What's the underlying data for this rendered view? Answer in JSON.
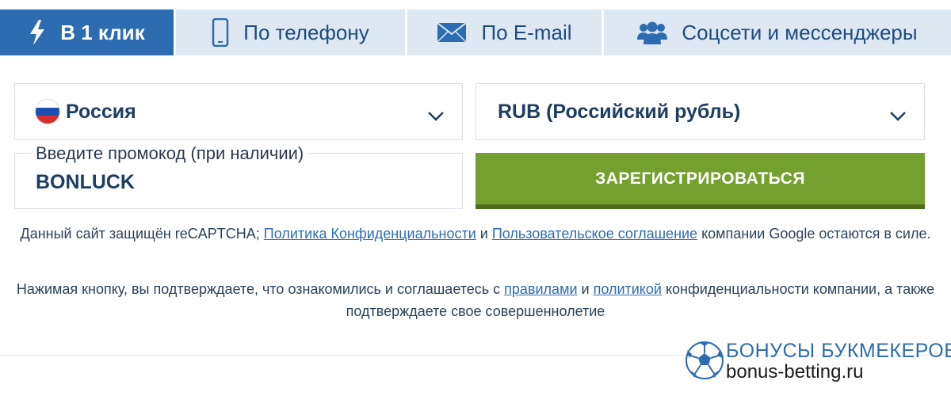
{
  "tabs": [
    {
      "label": "В 1 клик",
      "icon": "lightning-icon"
    },
    {
      "label": "По телефону",
      "icon": "phone-icon"
    },
    {
      "label": "По E-mail",
      "icon": "envelope-icon"
    },
    {
      "label": "Соцсети и мессенджеры",
      "icon": "users-icon"
    }
  ],
  "form": {
    "country": {
      "value": "Россия",
      "icon": "russia-flag-icon"
    },
    "currency": {
      "value": "RUB (Российский рубль)"
    },
    "promo": {
      "label": "Введите промокод (при наличии)",
      "value": "BONLUCK"
    },
    "register_label": "ЗАРЕГИСТРИРОВАТЬСЯ"
  },
  "notes": {
    "recaptcha": {
      "text1": "Данный сайт защищён reCAPTCHA; ",
      "link1": "Политика Конфиденциальности",
      "text2": " и ",
      "link2": "Пользовательское соглашение",
      "text3": " компании Google остаются в силе."
    },
    "agreement": {
      "text1": "Нажимая кнопку, вы подтверждаете, что ознакомились и соглашаетесь с ",
      "link1": "правилами",
      "text2": " и ",
      "link2": "политикой",
      "text3": " конфиденциальности компании, а также подтверждаете свое совершеннолетие"
    }
  },
  "watermark": {
    "title": "БОНУСЫ БУКМЕКЕРОВ",
    "url": "bonus-betting.ru"
  },
  "colors": {
    "accent": "#2e6cb2",
    "tab_bg": "#dde8f3",
    "register": "#74a030",
    "text": "#1d3e63"
  }
}
